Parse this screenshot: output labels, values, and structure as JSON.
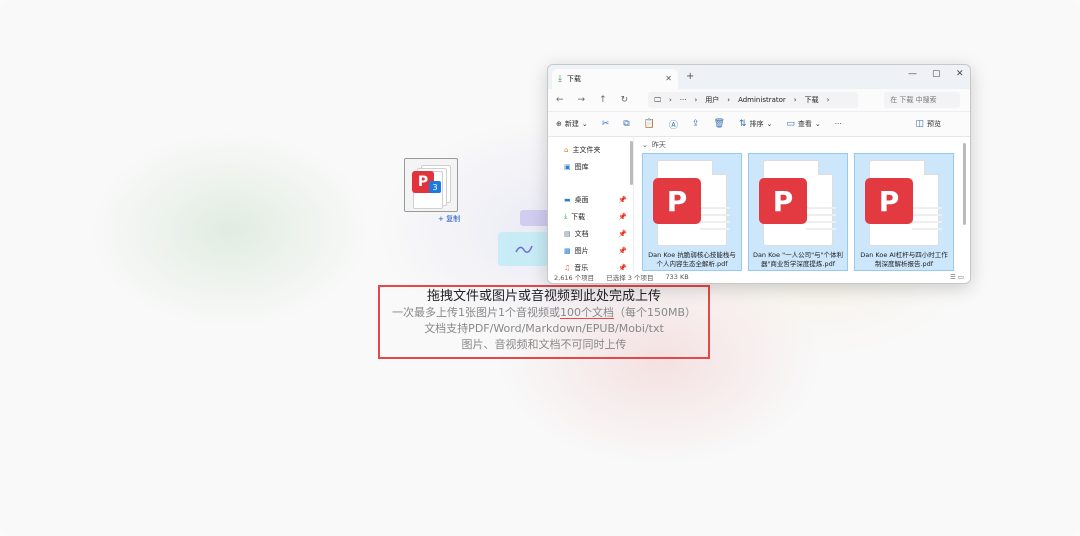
{
  "drag": {
    "count_badge": "3",
    "pdf_glyph": "P",
    "copy_hint": "+ 复制"
  },
  "dropzone": {
    "title": "拖拽文件或图片或音视频到此处完成上传",
    "line1_pre": "一次最多上传1张图片1个音视频或",
    "line1_hl": "100个文档",
    "line1_post": "（每个150MB）",
    "line2": "文档支持PDF/Word/Markdown/EPUB/Mobi/txt",
    "line3": "图片、音视频和文档不可同时上传"
  },
  "explorer": {
    "tab_title": "下载",
    "new_tab": "+",
    "window_controls": [
      "—",
      "▢",
      "✕"
    ],
    "breadcrumb": [
      "用户",
      "Administrator",
      "下载"
    ],
    "search_placeholder": "在 下载 中搜索",
    "toolbar": {
      "new_label": "新建",
      "sort_label": "排序",
      "view_label": "查看",
      "more_label": "···",
      "preview_label": "预览"
    },
    "sidebar": {
      "top": [
        "主文件夹",
        "图库"
      ],
      "pinned": [
        "桌面",
        "下载",
        "文档",
        "图片",
        "音乐"
      ]
    },
    "group_label": "昨天",
    "files": [
      {
        "name": "Dan Koe 抗脆弱核心技能栈与个人内容生态全解析.pdf"
      },
      {
        "name": "Dan Koe \"一人公司\"与\"个体利器\"商业哲学深度提炼.pdf"
      },
      {
        "name": "Dan Koe AI杠杆与四小时工作制深度解析报告.pdf"
      }
    ],
    "status": {
      "total": "2,616 个项目",
      "selected": "已选择 3 个项目",
      "size": "733 KB"
    }
  }
}
